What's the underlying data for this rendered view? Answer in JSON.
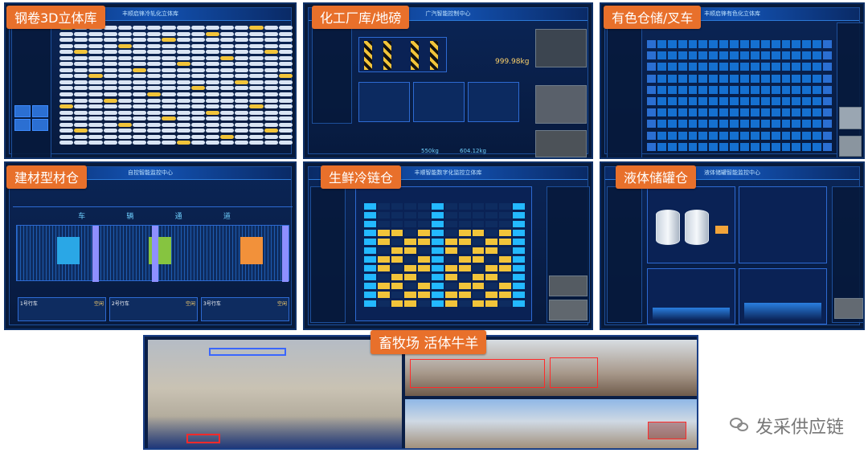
{
  "panels": [
    {
      "label": "钢卷3D立体库",
      "title": "丰顺启锋冷轧化立体库"
    },
    {
      "label": "化工厂库/地磅",
      "title": "广汽智能控制中心",
      "weights": [
        "999.98kg",
        "550kg",
        "604.12kg"
      ]
    },
    {
      "label": "有色仓储/叉车",
      "title": "丰顺启锋有色化立体库"
    },
    {
      "label": "建材型材仓",
      "title": "自控智能监控中心",
      "stats_row": "1号行车 2号行车 3号行车",
      "cranes": [
        "1号行车",
        "2号行车",
        "3号行车"
      ],
      "crane_status": "空闲",
      "zones": [
        "车",
        "辆",
        "通",
        "道"
      ]
    },
    {
      "label": "生鲜冷链仓",
      "title": "丰顺智能数字化监控立体库"
    },
    {
      "label": "液体储罐仓",
      "title": "液体储罐智能监控中心"
    },
    {
      "label": "畜牧场 活体牛羊"
    }
  ],
  "watermark": {
    "text": "发采供应链",
    "icon": "wechat-icon"
  },
  "colors": {
    "badge": "#e8702b",
    "panel_bg": "#081a3a",
    "accent": "#23b9ff"
  }
}
